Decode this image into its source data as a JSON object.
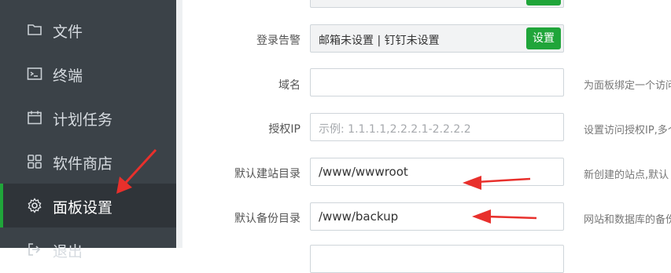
{
  "sidebar": {
    "items": [
      {
        "label": "文件",
        "icon": "folder-icon"
      },
      {
        "label": "终端",
        "icon": "terminal-icon"
      },
      {
        "label": "计划任务",
        "icon": "calendar-icon"
      },
      {
        "label": "软件商店",
        "icon": "grid-icon"
      },
      {
        "label": "面板设置",
        "icon": "gear-icon",
        "active": true
      },
      {
        "label": "退出",
        "icon": "exit-icon"
      }
    ]
  },
  "form": {
    "alert": {
      "label": "登录告警",
      "value": "邮箱未设置 | 钉钉未设置",
      "button": "设置"
    },
    "domain": {
      "label": "域名",
      "value": "",
      "hint": "为面板绑定一个访问域名"
    },
    "auth_ip": {
      "label": "授权IP",
      "placeholder": "示例: 1.1.1.1,2.2.2.1-2.2.2.2",
      "hint": "设置访问授权IP,多个"
    },
    "site_dir": {
      "label": "默认建站目录",
      "value": "/www/wwwroot",
      "hint": "新创建的站点,默认"
    },
    "backup_dir": {
      "label": "默认备份目录",
      "value": "/www/backup",
      "hint": "网站和数据库的备份"
    }
  },
  "colors": {
    "accent": "#20a53a",
    "sidebar_bg": "#3b4248",
    "arrow": "#e8302c"
  }
}
